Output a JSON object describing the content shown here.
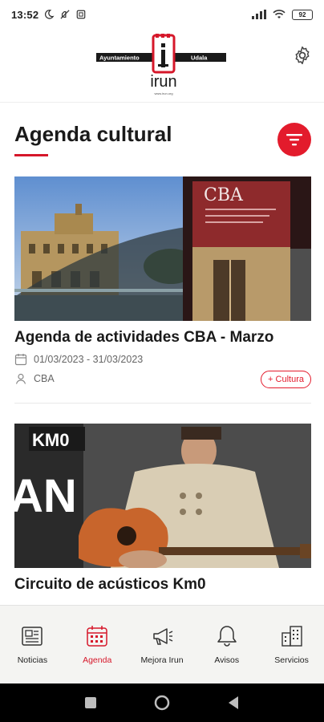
{
  "status_bar": {
    "time": "13:52",
    "battery": "92"
  },
  "header": {
    "logo_left_text": "Ayuntamiento",
    "logo_right_text": "Udala",
    "logo_city": "irun",
    "logo_sub": "www.irun.org",
    "settings_icon": "gear-icon"
  },
  "section": {
    "title": "Agenda cultural",
    "filter_icon": "filter-icon",
    "accent_color": "#e31b2c"
  },
  "events": [
    {
      "title": "Agenda de actividades CBA - Marzo",
      "dates": "01/03/2023 - 31/03/2023",
      "location": "CBA",
      "tag": "+ Cultura",
      "image_sign": "CBA"
    },
    {
      "title": "Circuito de acústicos Km0",
      "image_sign": "KM0",
      "image_big_text": "AN"
    }
  ],
  "bottom_nav": [
    {
      "label": "Noticias",
      "icon": "newspaper-icon"
    },
    {
      "label": "Agenda",
      "icon": "calendar-icon",
      "active": true
    },
    {
      "label": "Mejora Irun",
      "icon": "megaphone-icon"
    },
    {
      "label": "Avisos",
      "icon": "bell-icon"
    },
    {
      "label": "Servicios",
      "icon": "buildings-icon"
    }
  ]
}
